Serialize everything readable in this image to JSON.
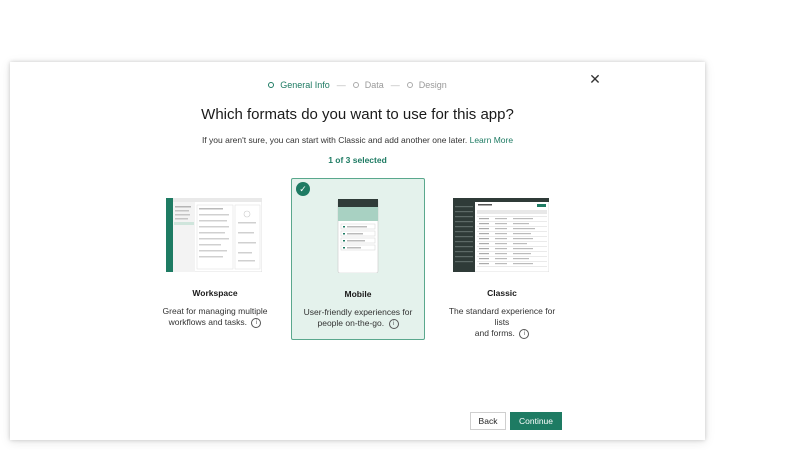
{
  "stepper": {
    "steps": [
      {
        "label": "General Info"
      },
      {
        "label": "Data"
      },
      {
        "label": "Design"
      }
    ],
    "separator": "—"
  },
  "dialog": {
    "close_glyph": "✕",
    "title": "Which formats do you want to use for this app?",
    "subtitle": "If you aren't sure, you can start with Classic and add another one later.",
    "learn_more": "Learn More",
    "selected_count": "1 of 3 selected"
  },
  "cards": [
    {
      "name": "Workspace",
      "desc_line1": "Great for managing multiple",
      "desc_line2": "workflows and tasks.",
      "selected": false
    },
    {
      "name": "Mobile",
      "desc_line1": "User-friendly experiences for",
      "desc_line2": "people on-the-go.",
      "selected": true
    },
    {
      "name": "Classic",
      "desc_line1": "The standard experience for lists",
      "desc_line2": "and forms.",
      "selected": false
    }
  ],
  "buttons": {
    "back": "Back",
    "continue": "Continue"
  },
  "colors": {
    "accent": "#1e7b63",
    "selected_bg": "#e4f2ec",
    "dark_header": "#2f3b38"
  },
  "icons": {
    "info": "i",
    "check": "✓"
  }
}
